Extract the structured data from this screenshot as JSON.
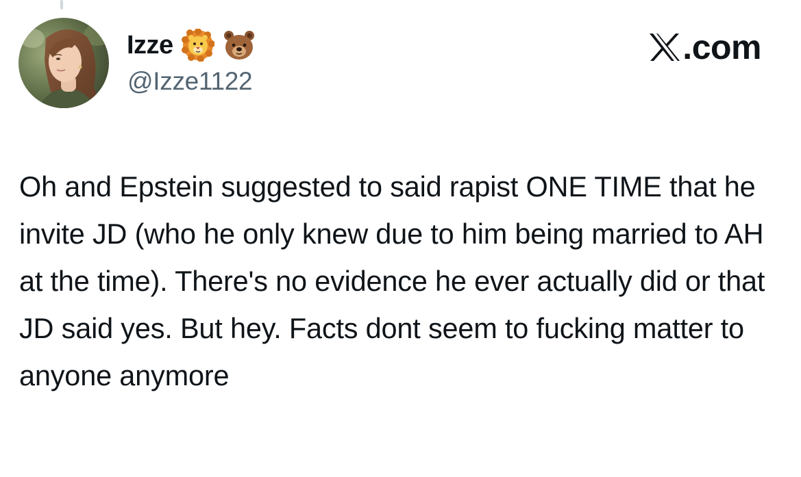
{
  "author": {
    "display_name": "Izze",
    "handle": "@Izze1122",
    "badges": [
      "lion-face-emoji",
      "bear-face-emoji"
    ],
    "avatar": "profile-photo"
  },
  "source": {
    "icon": "x-logo-icon",
    "label": ".com"
  },
  "tweet": {
    "text": "Oh and Epstein suggested to said rapist ONE TIME that he invite JD (who he only knew due to him being married to AH at the time). There's no evidence he ever actually did or that JD said yes. But hey. Facts dont seem to fucking matter to anyone anymore"
  },
  "colors": {
    "text_primary": "#0f1419",
    "text_secondary": "#536471",
    "thread_line": "#cfd9de",
    "background": "#ffffff"
  }
}
